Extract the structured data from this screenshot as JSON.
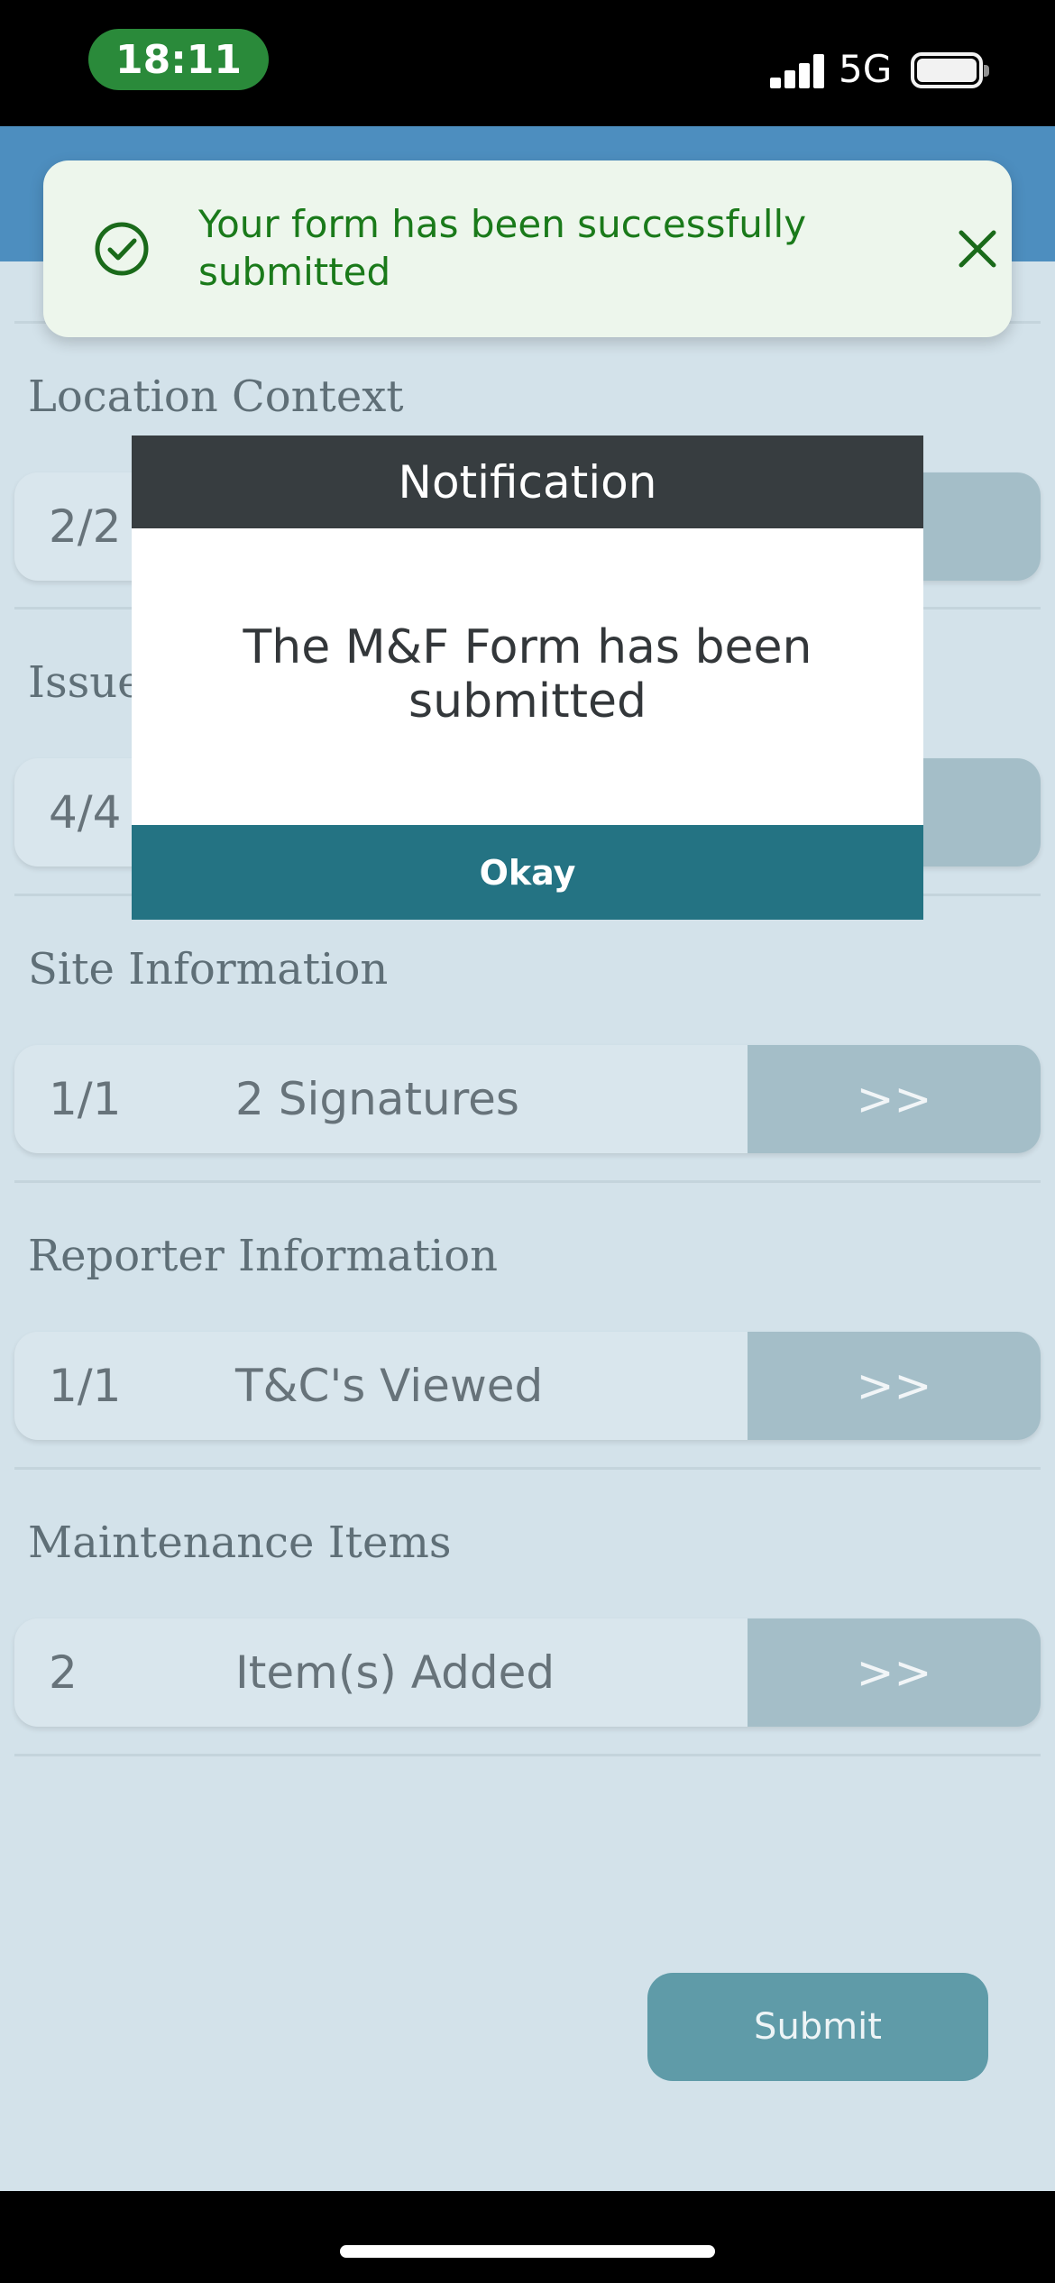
{
  "status_bar": {
    "time": "18:11",
    "network": "5G",
    "icons": [
      "signal-icon",
      "battery-icon"
    ],
    "time_pill_color": "#2a8a3a"
  },
  "sections": [
    {
      "title": "Location Context",
      "count": "2/2",
      "label": "",
      "action": ""
    },
    {
      "title": "Issue",
      "count": "4/4",
      "label": "",
      "action": ""
    },
    {
      "title": "Site Information",
      "count": "1/1",
      "label": "2 Signatures",
      "action": ">>"
    },
    {
      "title": "Reporter Information",
      "count": "1/1",
      "label": "T&C's Viewed",
      "action": ">>"
    },
    {
      "title": "Maintenance Items",
      "count": "2",
      "label": "Item(s) Added",
      "action": ">>"
    }
  ],
  "submit": {
    "label": "Submit"
  },
  "toast": {
    "message": "Your form has been successfully submitted",
    "icon": "check-circle-icon",
    "close_icon": "close-icon",
    "color": "#1a7a1a"
  },
  "modal": {
    "title": "Notification",
    "message": "The M&F Form has been submitted",
    "button": "Okay",
    "button_color": "#247383"
  },
  "colors": {
    "background": "#d3e2ea",
    "header": "#4d8ebf"
  }
}
